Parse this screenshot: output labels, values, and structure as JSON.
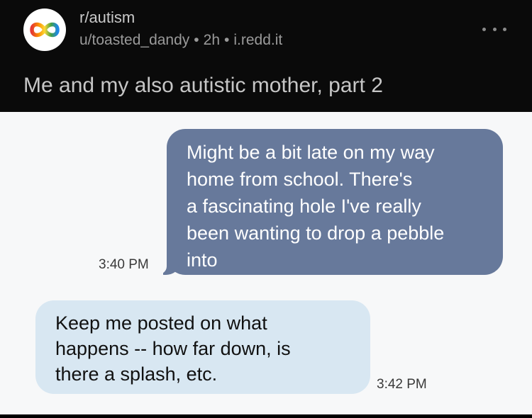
{
  "post": {
    "subreddit": "r/autism",
    "author": "u/toasted_dandy",
    "age": "2h",
    "domain": "i.redd.it",
    "separator": "•",
    "title": "Me and my also autistic mother, part 2"
  },
  "icons": {
    "avatar": "infinity-logo-icon",
    "more": "more-options-icon"
  },
  "colors": {
    "outgoing_bubble": "#67799b",
    "incoming_bubble": "#d8e7f2"
  },
  "messages": [
    {
      "direction": "outgoing",
      "lines": [
        "Might be a bit late on my way",
        "home from school. There's",
        "a fascinating hole I've really",
        "been wanting to drop a pebble",
        "into"
      ],
      "time": "3:40 PM"
    },
    {
      "direction": "incoming",
      "lines": [
        "Keep me posted on what",
        "happens -- how far down, is",
        "there a splash, etc."
      ],
      "time": "3:42 PM"
    }
  ]
}
